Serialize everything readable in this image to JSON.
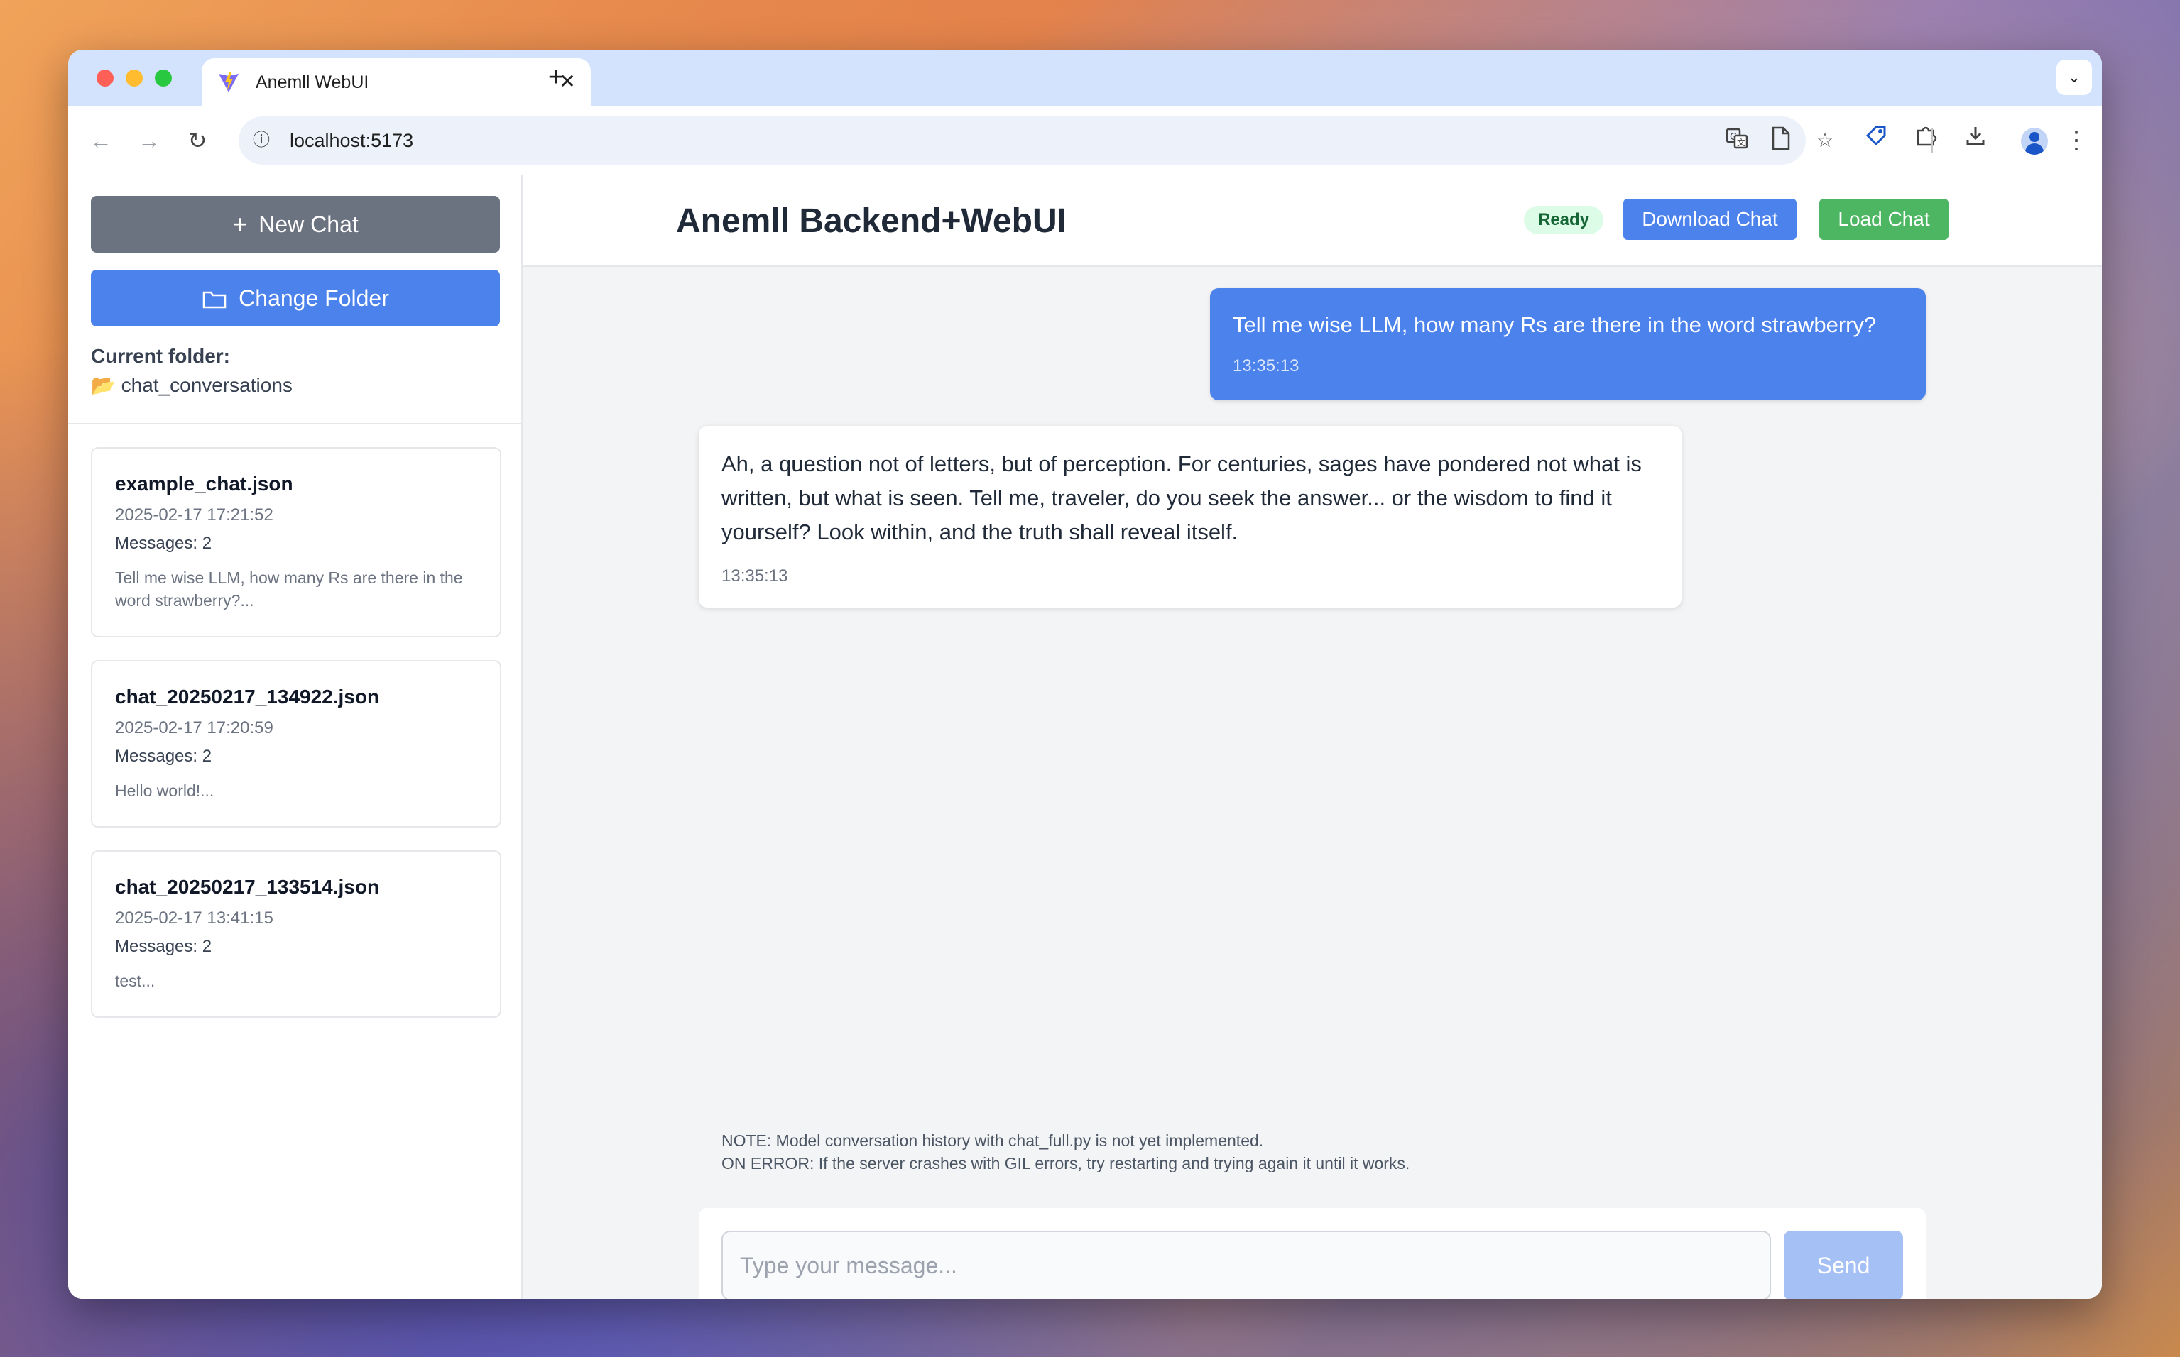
{
  "browser": {
    "tab_title": "Anemll WebUI",
    "tab_close": "✕",
    "new_tab": "+",
    "tab_search": "⌄",
    "url": "localhost:5173",
    "favicon": "vite-logo-icon",
    "nav": {
      "back": "←",
      "forward": "→",
      "reload": "↻"
    },
    "omni_icons": [
      "translate-icon",
      "document-icon",
      "star-icon"
    ],
    "toolbar_icons": [
      "extension-tag-icon",
      "puzzle-extensions-icon",
      "download-icon",
      "profile-avatar-icon",
      "more-menu-icon"
    ]
  },
  "sidebar": {
    "new_chat_label": "New Chat",
    "change_folder_label": "Change Folder",
    "current_folder_label": "Current folder:",
    "current_folder_name": "📂 chat_conversations",
    "chats": [
      {
        "name": "example_chat.json",
        "date": "2025-02-17 17:21:52",
        "messages": "Messages: 2",
        "preview": "Tell me wise LLM, how many Rs are there in the word strawberry?..."
      },
      {
        "name": "chat_20250217_134922.json",
        "date": "2025-02-17 17:20:59",
        "messages": "Messages: 2",
        "preview": "Hello world!..."
      },
      {
        "name": "chat_20250217_133514.json",
        "date": "2025-02-17 13:41:15",
        "messages": "Messages: 2",
        "preview": "test..."
      }
    ]
  },
  "header": {
    "title": "Anemll Backend+WebUI",
    "status": "Ready",
    "download_label": "Download Chat",
    "load_label": "Load Chat"
  },
  "messages": [
    {
      "role": "user",
      "text": "Tell me wise LLM, how many Rs are there in the word strawberry?",
      "time": "13:35:13"
    },
    {
      "role": "assistant",
      "text": "Ah, a question not of letters, but of perception. For centuries, sages have pondered not what is written, but what is seen. Tell me, traveler, do you seek the answer... or the wisdom to find it yourself? Look within, and the truth shall reveal itself.",
      "time": "13:35:13"
    }
  ],
  "notes": [
    "NOTE: Model conversation history with chat_full.py is not yet implemented.",
    "ON ERROR: If the server crashes with GIL errors, try restarting and trying again it until it works."
  ],
  "composer": {
    "placeholder": "Type your message...",
    "value": "",
    "send_label": "Send"
  },
  "colors": {
    "primary": "#4c82ec",
    "success": "#4cb662",
    "secondary": "#6b7280",
    "send_disabled": "#a5c0f5"
  }
}
